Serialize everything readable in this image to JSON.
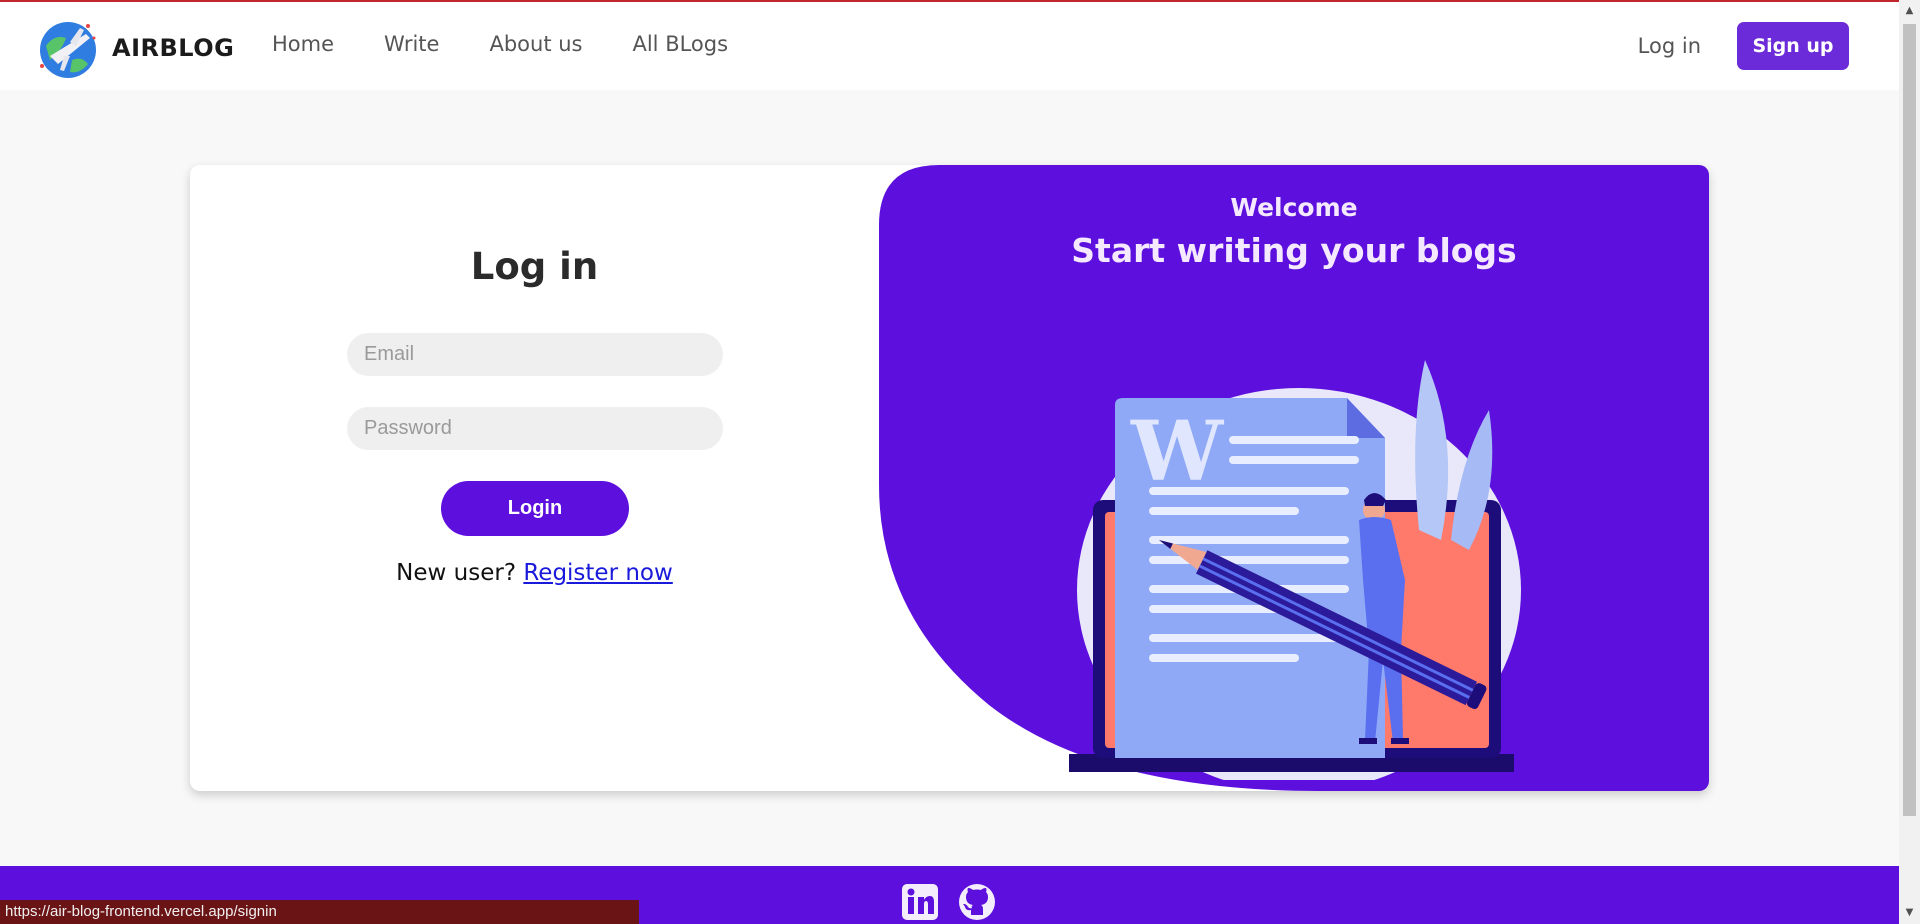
{
  "brand": {
    "name": "AIRBLOG",
    "logo_icon": "airplane-globe-logo"
  },
  "nav": {
    "links": [
      {
        "label": "Home"
      },
      {
        "label": "Write"
      },
      {
        "label": "About us"
      },
      {
        "label": "All BLogs"
      }
    ],
    "login_label": "Log in",
    "signup_label": "Sign up"
  },
  "login": {
    "title": "Log in",
    "email_placeholder": "Email",
    "password_placeholder": "Password",
    "button_label": "Login",
    "new_user_text": "New user?",
    "register_link": "Register now"
  },
  "welcome": {
    "subtitle": "Welcome",
    "title": "Start writing your blogs",
    "illustration_icon": "blog-writing-illustration"
  },
  "footer": {
    "icons": [
      "linkedin-icon",
      "github-icon"
    ]
  },
  "status_bar": {
    "url": "https://air-blog-frontend.vercel.app/signin"
  },
  "colors": {
    "brand_purple": "#5c0fdd",
    "signup_purple": "#6c2bd9",
    "page_bg": "#f8f8f8",
    "accent_red": "#c2262d"
  }
}
